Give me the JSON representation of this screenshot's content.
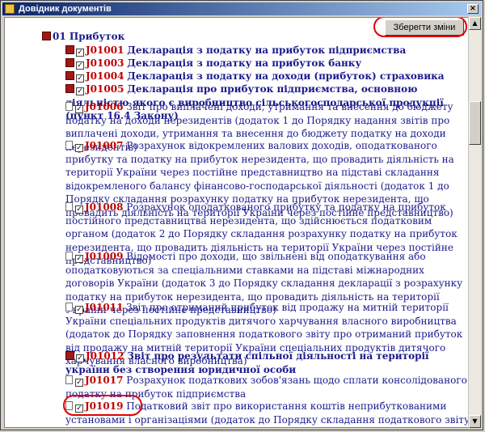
{
  "window": {
    "title": "Довідник документів",
    "close": "×"
  },
  "toolbar": {
    "save_label": "Зберегти зміни"
  },
  "group": {
    "label": "01 Прибуток"
  },
  "items": [
    {
      "code": "J01001",
      "name": "Декларація з податку на прибуток підприємства",
      "bold": true,
      "icon": "book-icon"
    },
    {
      "code": "J01003",
      "name": "Декларація з податку на прибуток банку",
      "bold": true,
      "icon": "book-icon"
    },
    {
      "code": "J01004",
      "name": "Декларація з податку на доходи (прибуток) страховика",
      "bold": true,
      "icon": "book-icon"
    },
    {
      "code": "J01005",
      "name": "Декларація про прибуток підприємства, основною діяльністю якого є виробництво сільськогосподарської продукції (пункт 16.4 Закону)",
      "bold": true,
      "icon": "book-icon"
    },
    {
      "code": "J01006",
      "name": "Звіт про виплачені доходи, утримання та внесення до бюджету податку на доходи нерезидентів (додаток 1 до Порядку надання звітів про виплачені доходи, утримання та внесення до бюджету податку на доходи нерезидентів)",
      "bold": false,
      "icon": "document-icon"
    },
    {
      "code": "J01007",
      "name": "Розрахунок відокремлених валових доходів, оподаткованого прибутку та податку на прибуток нерезидента, що провадить діяльність на території України через постійне представництво на підставі складання відокремленого балансу фінансово-господарської діяльності (додаток 1 до Порядку складання розрахунку податку на прибуток нерезидента, що провадить діяльність на території України через постійне представництво)",
      "bold": false,
      "icon": "document-icon"
    },
    {
      "code": "J01008",
      "name": "Розрахунок оподаткованого прибутку та податку на прибуток постійного представництва нерезидента, що здійснюється податковим органом (додаток 2 до Порядку складання розрахунку податку на прибуток нерезидента, що провадить діяльність на території України через постійне представництво)",
      "bold": false,
      "icon": "document-icon"
    },
    {
      "code": "J01009",
      "name": "Відомості про доходи, що звільнені від оподаткування або оподатковуються за спеціальними ставками на підставі міжнародних договорів України (додаток 3 до Порядку складання декларації з розрахунку податку на прибуток нерезидента, що провадить діяльність на території України через постійне представництво)",
      "bold": false,
      "icon": "document-icon"
    },
    {
      "code": "J01011",
      "name": "Звіт про отриманий прибуток від продажу на митній території України спеціальних продуктів дитячого харчування власного виробництва (додаток до Порядку заповнення податкового звіту про отриманий прибуток від продажу на митній території України спеціальних продуктів дитячого харчування власного виробництва)",
      "bold": false,
      "icon": "document-icon"
    },
    {
      "code": "J01012",
      "name": "Звіт про результати спільної діяльності на території україни без створення юридичної особи",
      "bold": true,
      "icon": "book-icon"
    },
    {
      "code": "J01017",
      "name": "Розрахунок податкових зобов'язань щодо сплати консолідованого податку на прибуток підприємства",
      "bold": false,
      "icon": "document-icon"
    },
    {
      "code": "J01019",
      "name": "Податковий звіт про використання коштів неприбуткованими установами і організаціями (додаток до Порядку складання податкового звіту про використання коштів неприбуткових",
      "bold": false,
      "icon": "document-icon"
    }
  ]
}
